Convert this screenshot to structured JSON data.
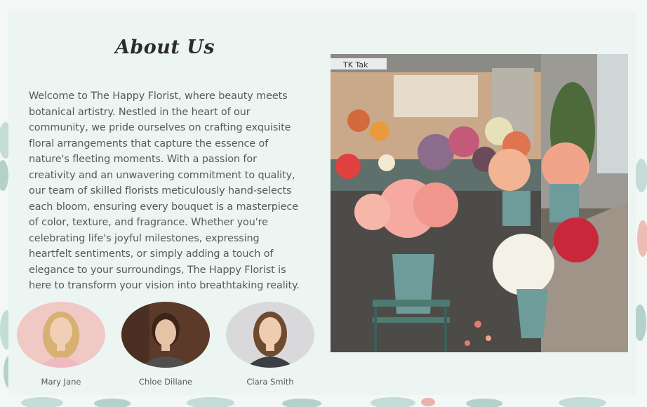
{
  "about": {
    "title": "About Us",
    "body": "Welcome to The Happy Florist, where beauty meets botanical artistry. Nestled in the heart of our community, we pride ourselves on crafting exquisite floral arrangements that capture the essence of nature's fleeting moments. With a passion for creativity and an unwavering commitment to quality, our team of skilled florists meticulously hand-selects each bloom, ensuring every bouquet is a masterpiece of color, texture, and fragrance. Whether you're celebrating life's joyful milestones, expressing heartfelt sentiments, or simply adding a touch of elegance to your surroundings, The Happy Florist is here to transform your vision into breathtaking reality."
  },
  "team": [
    {
      "name": "Mary Jane",
      "photo_bg": "#f1c9c4",
      "hair": "#d7b072",
      "shirt": "#efb9c2"
    },
    {
      "name": "Chloe Dillane",
      "photo_bg": "#5b3a2a",
      "hair": "#3c2418",
      "shirt": "#4f4f4f"
    },
    {
      "name": "Clara Smith",
      "photo_bg": "#d9d9dc",
      "hair": "#6e4a2e",
      "shirt": "#3d3f45"
    }
  ],
  "shop_photo": {
    "sign_text": "TK Tak"
  },
  "colors": {
    "card_bg": "#edf5f2",
    "text": "#555a57",
    "leaf": "#7fb3a8",
    "petal": "#e47a6e"
  }
}
